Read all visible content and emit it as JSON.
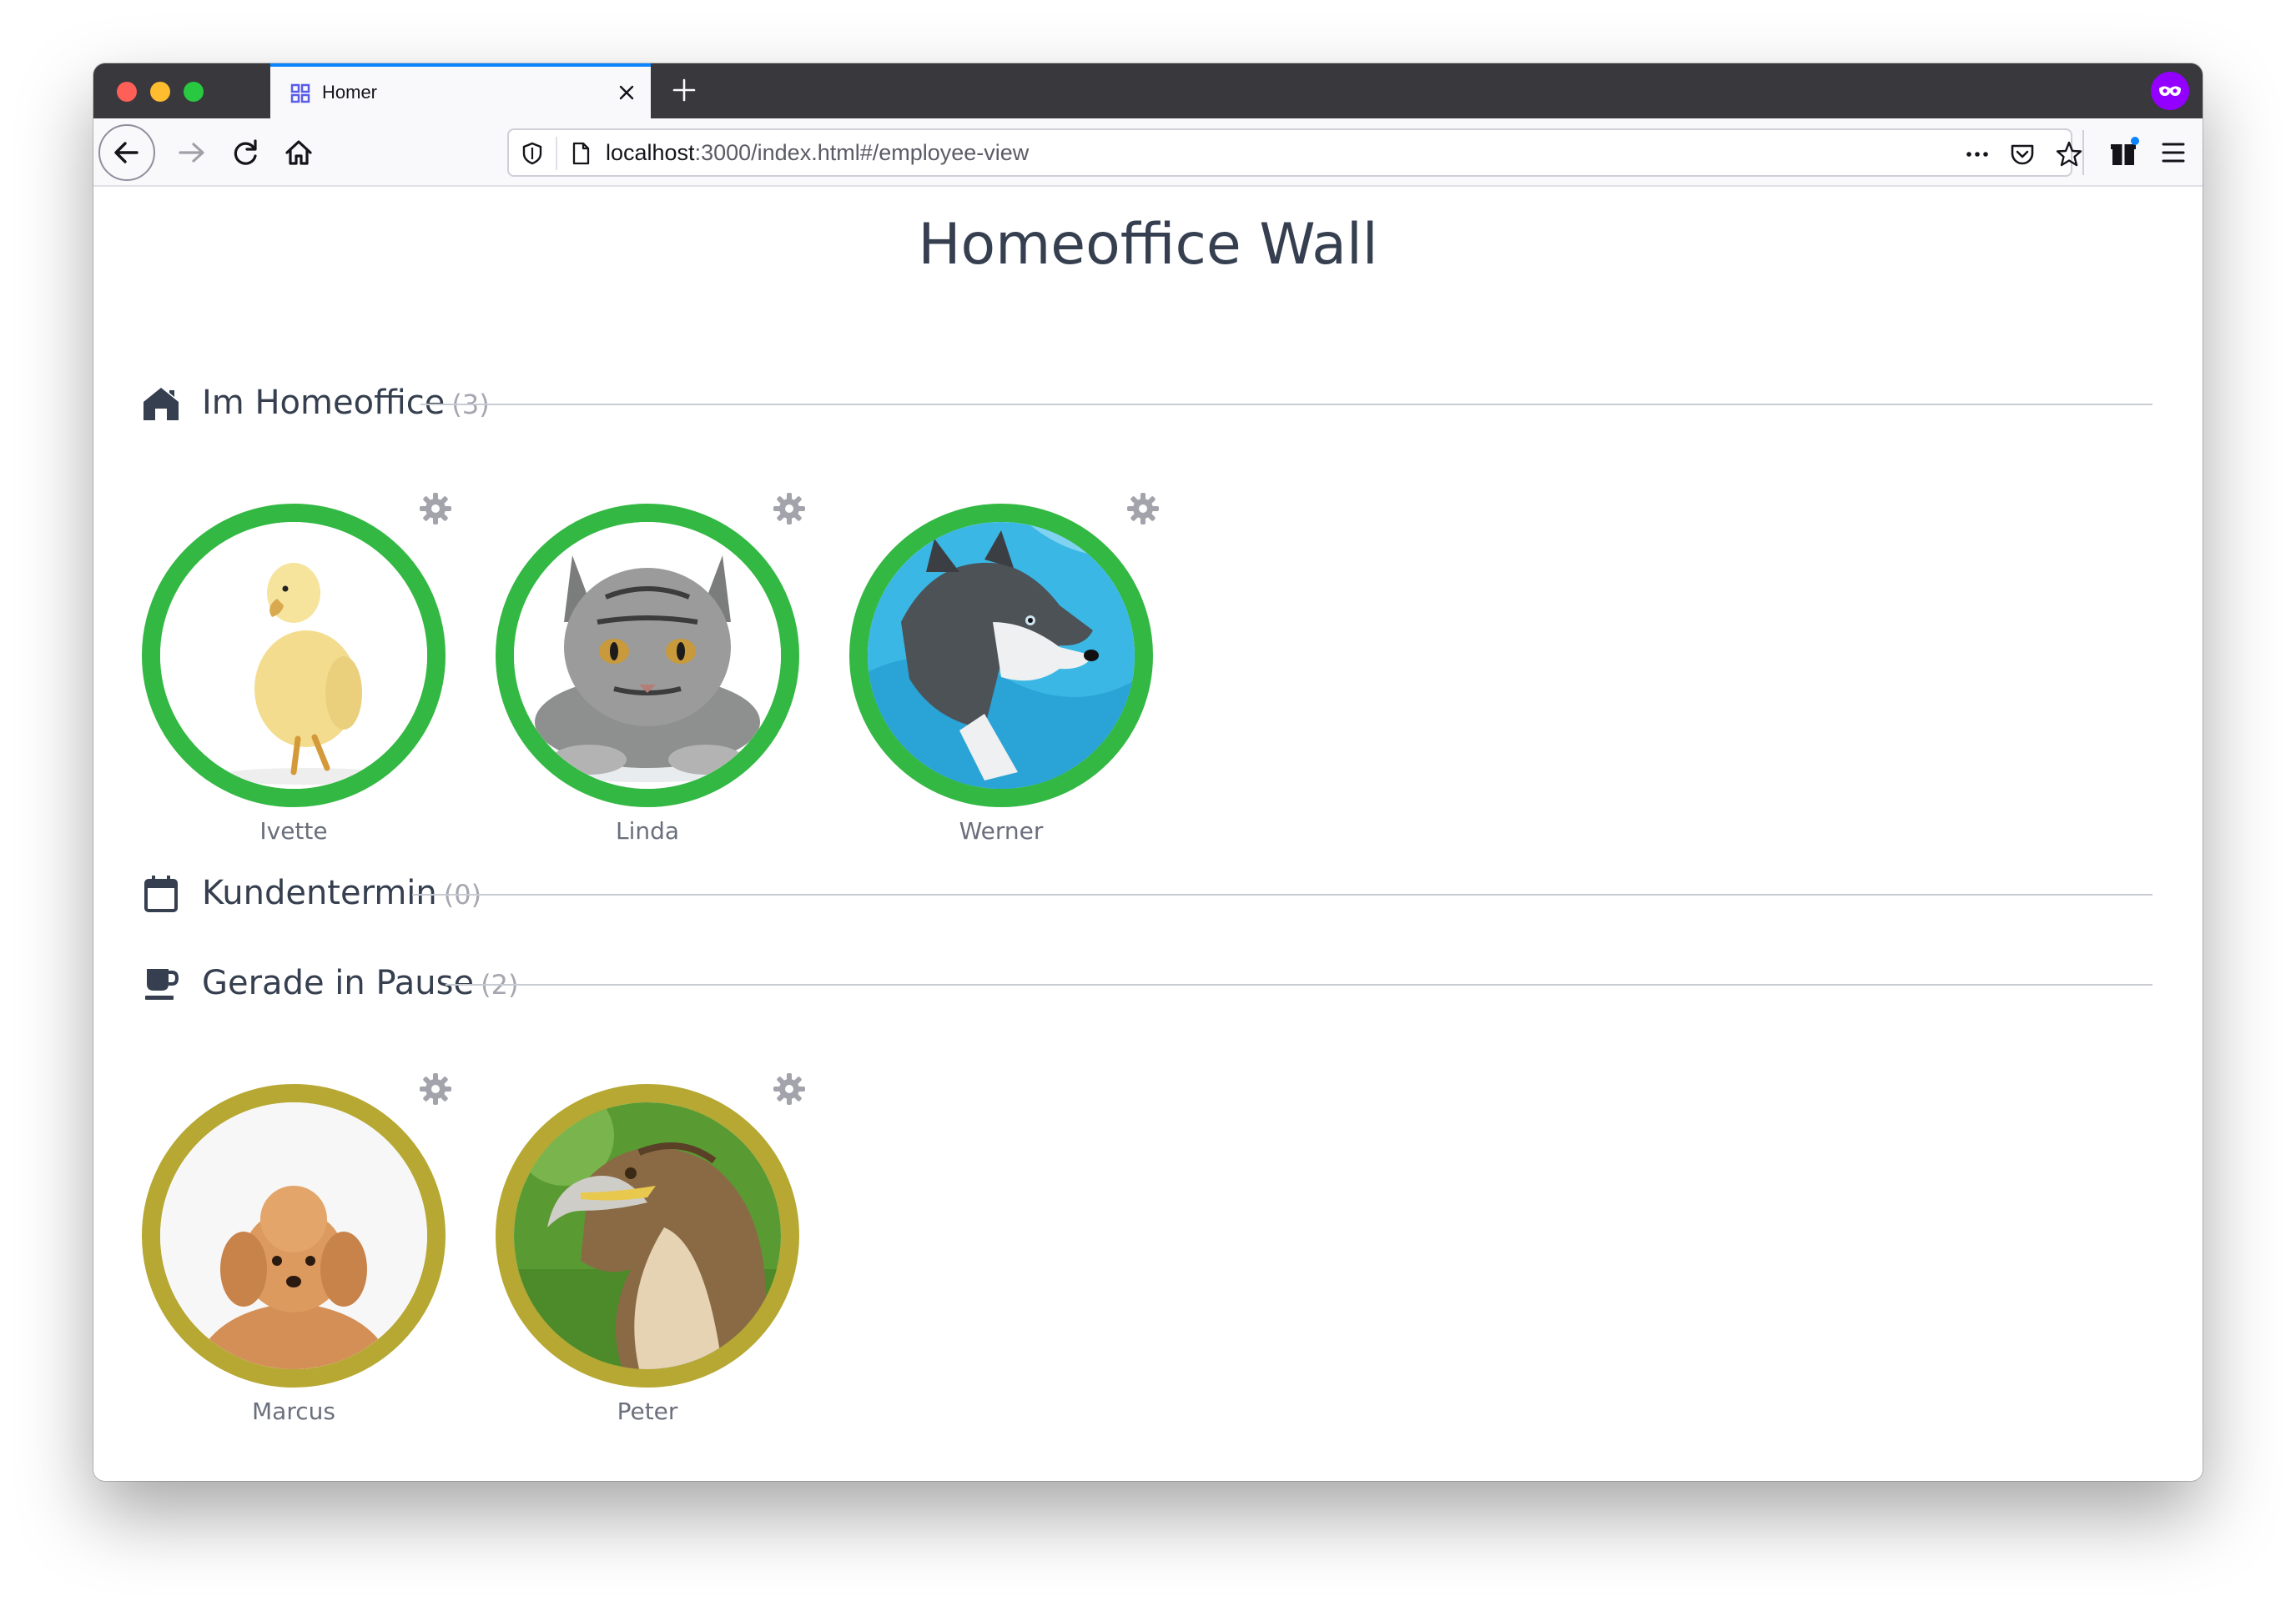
{
  "browser": {
    "tab_title": "Homer",
    "url_host": "localhost",
    "url_rest": ":3000/index.html#/employee-view",
    "accent": "#0a84ff"
  },
  "page": {
    "title": "Homeoffice Wall"
  },
  "sections": [
    {
      "label": "Im Homeoffice",
      "count": "(3)",
      "icon": "home-icon",
      "status_color": "#33b843",
      "people": [
        {
          "name": "Ivette",
          "photo": "duckling"
        },
        {
          "name": "Linda",
          "photo": "tabby-cat"
        },
        {
          "name": "Werner",
          "photo": "husky"
        }
      ]
    },
    {
      "label": "Kundentermin",
      "count": "(0)",
      "icon": "calendar-icon",
      "people": []
    },
    {
      "label": "Gerade in Pause",
      "count": "(2)",
      "icon": "coffee-cup-icon",
      "status_color": "#b6a832",
      "people": [
        {
          "name": "Marcus",
          "photo": "poodle"
        },
        {
          "name": "Peter",
          "photo": "eagle"
        }
      ]
    }
  ]
}
